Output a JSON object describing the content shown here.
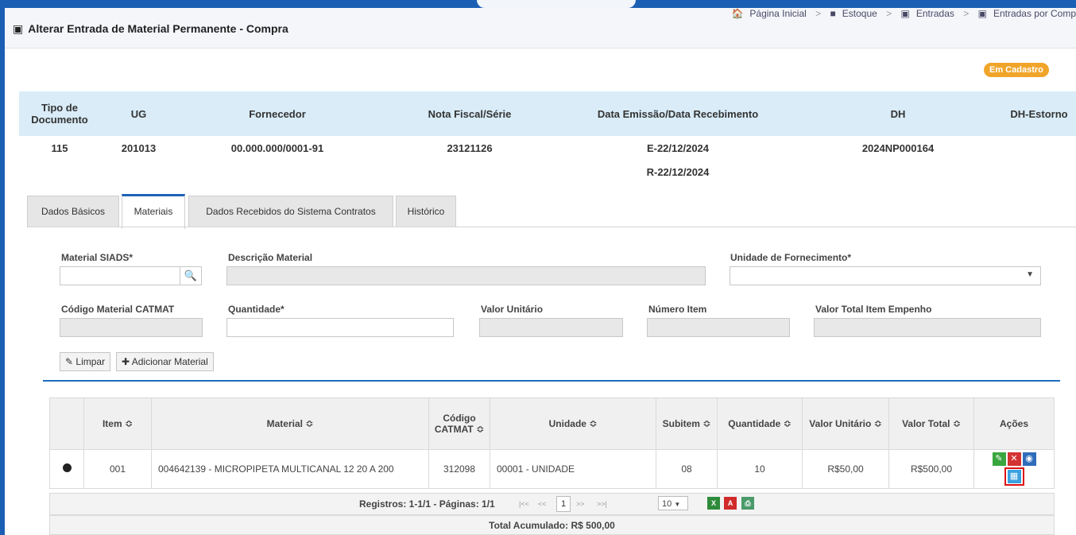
{
  "header": {
    "title": "Alterar Entrada de Material Permanente - Compra",
    "breadcrumbs": [
      "Página Inicial",
      "Estoque",
      "Entradas",
      "Entradas por Comp"
    ]
  },
  "status_badge": "Em Cadastro",
  "summary": {
    "headers": [
      "Tipo de Documento",
      "UG",
      "Fornecedor",
      "Nota Fiscal/Série",
      "Data Emissão/Data Recebimento",
      "DH",
      "DH-Estorno"
    ],
    "row": [
      "115",
      "201013",
      "00.000.000/0001-91",
      "23121126",
      "E-22/12/2024",
      "2024NP000164",
      ""
    ],
    "data_recebimento": "R-22/12/2024"
  },
  "tabs": [
    {
      "label": "Dados Básicos",
      "active": false
    },
    {
      "label": "Materiais",
      "active": true
    },
    {
      "label": "Dados Recebidos do Sistema Contratos",
      "active": false
    },
    {
      "label": "Histórico",
      "active": false
    }
  ],
  "form": {
    "material_siads": {
      "label": "Material SIADS*",
      "value": ""
    },
    "descricao": {
      "label": "Descrição Material",
      "value": ""
    },
    "unidade_fornecimento": {
      "label": "Unidade de Fornecimento*",
      "value": ""
    },
    "codigo_catmat": {
      "label": "Código Material CATMAT",
      "value": ""
    },
    "quantidade": {
      "label": "Quantidade*",
      "value": ""
    },
    "valor_unitario": {
      "label": "Valor Unitário",
      "value": ""
    },
    "numero_item": {
      "label": "Número Item",
      "value": ""
    },
    "valor_total_empenho": {
      "label": "Valor Total Item Empenho",
      "value": ""
    }
  },
  "buttons": {
    "limpar": "Limpar",
    "adicionar": "Adicionar Material"
  },
  "grid": {
    "headers": [
      "Item ≎",
      "Material ≎",
      "Código CATMAT ≎",
      "Unidade ≎",
      "Subitem ≎",
      "Quantidade ≎",
      "Valor Unitário ≎",
      "Valor Total ≎",
      "Ações"
    ],
    "rows": [
      {
        "item": "001",
        "material": "004642139 - MICROPIPETA MULTICANAL 12 20 A 200",
        "catmat": "312098",
        "unidade": "00001 - UNIDADE",
        "subitem": "08",
        "quantidade": "10",
        "valor_unitario": "R$50,00",
        "valor_total": "R$500,00"
      }
    ]
  },
  "pager": {
    "text": "Registros: 1-1/1 - Páginas: 1/1",
    "current_page": "1",
    "per_page": "10"
  },
  "total": "Total Acumulado: R$ 500,00",
  "colors": {
    "accent": "#1b5fb4",
    "badge": "#f0a52a",
    "summary_header": "#d9ecf8"
  }
}
